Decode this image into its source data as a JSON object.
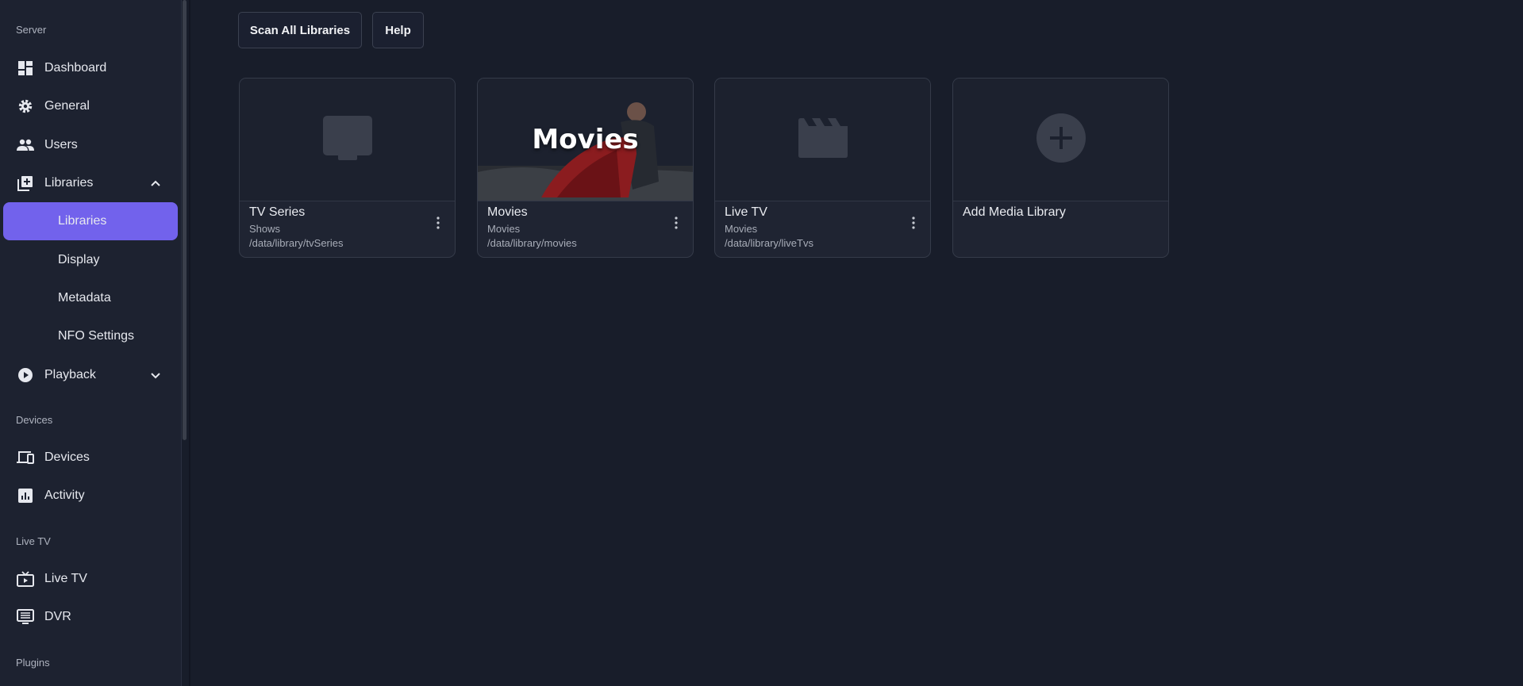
{
  "sidebar": {
    "sections": {
      "server": "Server",
      "devices": "Devices",
      "live_tv": "Live TV",
      "plugins": "Plugins"
    },
    "items": {
      "dashboard": "Dashboard",
      "general": "General",
      "users": "Users",
      "libraries": "Libraries",
      "playback": "Playback",
      "devices": "Devices",
      "activity": "Activity",
      "live_tv": "Live TV",
      "dvr": "DVR"
    },
    "sub_items": {
      "libraries": "Libraries",
      "display": "Display",
      "metadata": "Metadata",
      "nfo_settings": "NFO Settings"
    }
  },
  "toolbar": {
    "scan_all": "Scan All Libraries",
    "help": "Help"
  },
  "libraries": [
    {
      "title": "TV Series",
      "type": "Shows",
      "path": "/data/library/tvSeries",
      "icon": "tv-icon"
    },
    {
      "title": "Movies",
      "type": "Movies",
      "path": "/data/library/movies",
      "thumb_text": "Movies"
    },
    {
      "title": "Live TV",
      "type": "Movies",
      "path": "/data/library/liveTvs",
      "icon": "clapperboard-icon"
    }
  ],
  "add_library": {
    "title": "Add Media Library",
    "icon": "plus-icon"
  },
  "colors": {
    "accent": "#7262ec",
    "background": "#181d2a",
    "sidebar": "#1d2230"
  }
}
